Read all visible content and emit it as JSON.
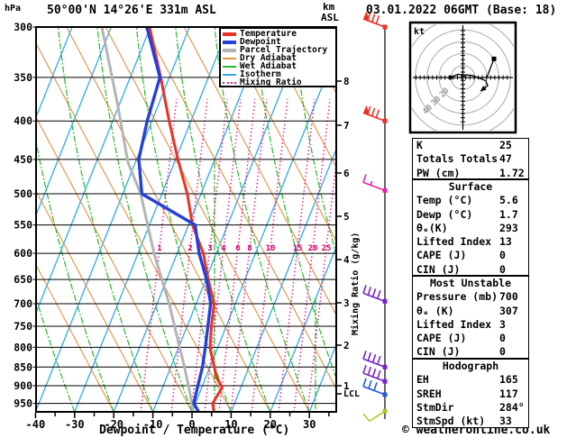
{
  "header": {
    "station": "50°00'N 14°26'E 331m ASL",
    "datetime": "03.01.2022 06GMT (Base: 18)",
    "pressure_unit": "hPa",
    "alt_unit": "km",
    "alt_ref": "ASL",
    "copyright": "© weatheronline.co.uk"
  },
  "legend": [
    {
      "label": "Temperature",
      "color": "#ee3124",
      "thick": true,
      "dotted": false
    },
    {
      "label": "Dewpoint",
      "color": "#2440d8",
      "thick": true,
      "dotted": false
    },
    {
      "label": "Parcel Trajectory",
      "color": "#b4b4b4",
      "thick": true,
      "dotted": false
    },
    {
      "label": "Dry Adiabat",
      "color": "#e2913e",
      "thick": false,
      "dotted": false
    },
    {
      "label": "Wet Adiabat",
      "color": "#28b828",
      "thick": false,
      "dotted": false
    },
    {
      "label": "Isotherm",
      "color": "#30a8f0",
      "thick": false,
      "dotted": false
    },
    {
      "label": "Mixing Ratio",
      "color": "#e8188c",
      "thick": false,
      "dotted": true
    }
  ],
  "axes": {
    "pressure_ticks": [
      300,
      350,
      400,
      450,
      500,
      550,
      600,
      650,
      700,
      750,
      800,
      850,
      900,
      950
    ],
    "temperature_ticks": [
      -40,
      -30,
      -20,
      -10,
      0,
      10,
      20,
      30
    ],
    "xlabel": "Dewpoint / Temperature (°C)",
    "km_ticks": [
      8,
      7,
      6,
      5,
      4,
      3,
      2,
      1
    ],
    "lcl_label": "LCL",
    "mixing_axis_label": "Mixing Ratio (g/kg)",
    "mixing_ratio_values": [
      1,
      2,
      3,
      4,
      6,
      8,
      10,
      15,
      20,
      25
    ]
  },
  "hodograph": {
    "unit": "kt",
    "ring_labels": [
      20,
      30,
      40
    ]
  },
  "tables": [
    {
      "header": null,
      "rows": [
        [
          "K",
          "25"
        ],
        [
          "Totals Totals",
          "47"
        ],
        [
          "PW (cm)",
          "1.72"
        ]
      ]
    },
    {
      "header": "Surface",
      "rows": [
        [
          "Temp (°C)",
          "5.6"
        ],
        [
          "Dewp (°C)",
          "1.7"
        ],
        [
          "θₑ(K)",
          "293"
        ],
        [
          "Lifted Index",
          "13"
        ],
        [
          "CAPE (J)",
          "0"
        ],
        [
          "CIN (J)",
          "0"
        ]
      ]
    },
    {
      "header": "Most Unstable",
      "rows": [
        [
          "Pressure (mb)",
          "700"
        ],
        [
          "θₑ (K)",
          "307"
        ],
        [
          "Lifted Index",
          "3"
        ],
        [
          "CAPE (J)",
          "0"
        ],
        [
          "CIN (J)",
          "0"
        ]
      ]
    },
    {
      "header": "Hodograph",
      "rows": [
        [
          "EH",
          "165"
        ],
        [
          "SREH",
          "117"
        ],
        [
          "StmDir",
          "284°"
        ],
        [
          "StmSpd (kt)",
          "33"
        ]
      ]
    }
  ],
  "chart_data": {
    "type": "line",
    "variant": "skew-t-log-p",
    "xlabel": "Dewpoint / Temperature (°C)",
    "x_range_c": [
      -40,
      35
    ],
    "pressure_range_hpa": [
      300,
      975
    ],
    "series": [
      {
        "name": "Temperature",
        "color": "#ee3124",
        "width": 3,
        "points": [
          [
            975,
            5.6
          ],
          [
            950,
            4.4
          ],
          [
            905,
            5.2
          ],
          [
            878,
            2.8
          ],
          [
            850,
            1.1
          ],
          [
            800,
            -2.0
          ],
          [
            750,
            -3.8
          ],
          [
            700,
            -5.4
          ],
          [
            650,
            -9.4
          ],
          [
            600,
            -13.3
          ],
          [
            550,
            -19.0
          ],
          [
            500,
            -23.5
          ],
          [
            450,
            -29.4
          ],
          [
            400,
            -35.6
          ],
          [
            350,
            -42.2
          ],
          [
            300,
            -50.2
          ]
        ]
      },
      {
        "name": "Dewpoint",
        "color": "#2440d8",
        "width": 3.4,
        "points": [
          [
            975,
            1.7
          ],
          [
            950,
            -0.4
          ],
          [
            905,
            -1.1
          ],
          [
            850,
            -1.9
          ],
          [
            800,
            -3.2
          ],
          [
            750,
            -4.7
          ],
          [
            700,
            -6.3
          ],
          [
            650,
            -9.8
          ],
          [
            600,
            -14.4
          ],
          [
            550,
            -18.3
          ],
          [
            500,
            -35.1
          ],
          [
            450,
            -39.4
          ],
          [
            400,
            -41.2
          ],
          [
            350,
            -42.4
          ],
          [
            300,
            -50.9
          ]
        ]
      },
      {
        "name": "Parcel Trajectory",
        "color": "#b4b4b4",
        "width": 3,
        "points": [
          [
            975,
            0.3
          ],
          [
            938,
            -1.5
          ],
          [
            850,
            -6.5
          ],
          [
            788,
            -10.6
          ],
          [
            700,
            -16.9
          ],
          [
            600,
            -25.9
          ],
          [
            500,
            -35.4
          ],
          [
            454,
            -41.9
          ],
          [
            380,
            -50.5
          ],
          [
            300,
            -62.4
          ]
        ]
      }
    ],
    "wind_barbs": [
      {
        "pressure": 300,
        "color": "#ee3124",
        "type": "flag3"
      },
      {
        "pressure": 400,
        "color": "#ee3124",
        "type": "flag3"
      },
      {
        "pressure": 495,
        "color": "#ee22aa",
        "type": "barb15"
      },
      {
        "pressure": 695,
        "color": "#7722cc",
        "type": "barb4"
      },
      {
        "pressure": 850,
        "color": "#7722cc",
        "type": "barb4"
      },
      {
        "pressure": 888,
        "color": "#7722cc",
        "type": "barb4"
      },
      {
        "pressure": 925,
        "color": "#2255ee",
        "type": "barb3"
      },
      {
        "pressure": 973,
        "color": "#aac820",
        "type": "surface"
      }
    ],
    "hodograph_trace_kt": {
      "main": [
        [
          -12,
          0
        ],
        [
          -5,
          3
        ],
        [
          9,
          2
        ],
        [
          22,
          -3
        ],
        [
          24,
          -8
        ],
        [
          17,
          -13
        ]
      ],
      "upper_segment": [
        [
          30,
          18
        ],
        [
          23,
          0
        ]
      ],
      "start_dot": [
        -12,
        0
      ],
      "square_marker": [
        30,
        18
      ]
    }
  }
}
